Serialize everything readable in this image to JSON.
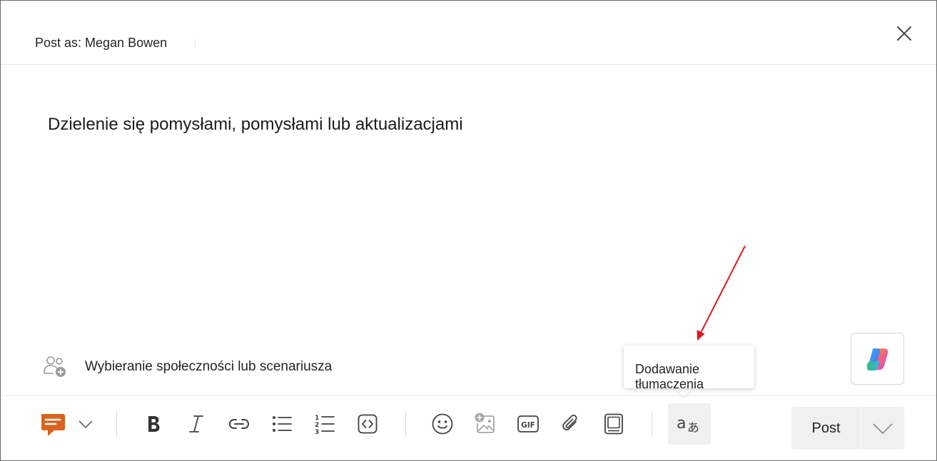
{
  "header": {
    "post_as_label": "Post as: Megan Bowen",
    "close_icon": "close-icon"
  },
  "composer": {
    "placeholder": "Dzielenie się pomysłami, pomysłami lub aktualizacjami"
  },
  "community": {
    "icon": "people-add-icon",
    "label": "Wybieranie społeczności lub scenariusza"
  },
  "copilot": {
    "icon": "copilot-icon"
  },
  "tooltip": {
    "text": "Dodawanie tłumaczenia"
  },
  "toolbar": {
    "message_type_icon": "discussion-icon",
    "message_type_color": "#D9631E",
    "buttons": [
      "bold-icon",
      "italic-icon",
      "link-icon",
      "bullet-list-icon",
      "numbered-list-icon",
      "code-icon",
      "emoji-icon",
      "image-add-icon",
      "gif-icon",
      "attach-icon",
      "article-icon",
      "translate-icon"
    ],
    "post_label": "Post"
  },
  "annotation": {
    "arrow_color": "#E0191F"
  }
}
